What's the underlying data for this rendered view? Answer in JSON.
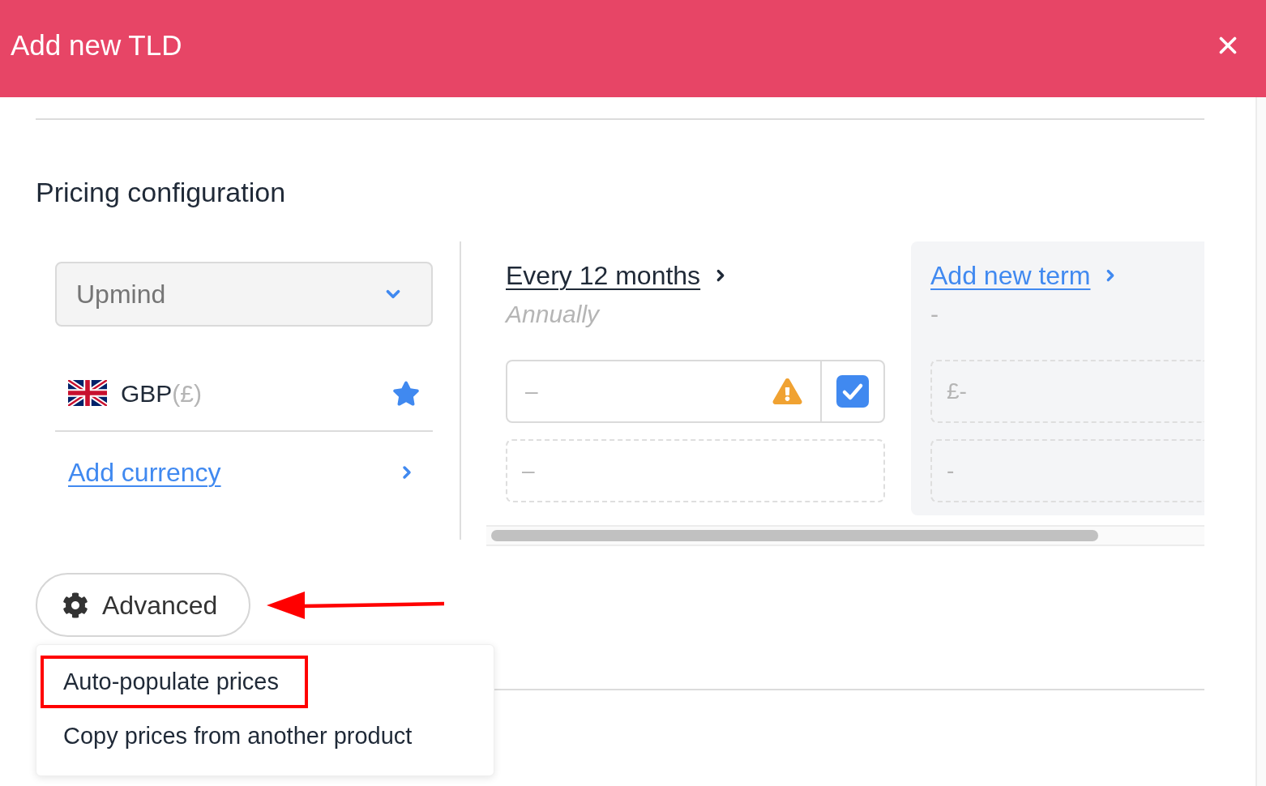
{
  "dialog": {
    "title": "Add new TLD"
  },
  "section": {
    "title": "Pricing configuration"
  },
  "brand_select": {
    "value": "Upmind"
  },
  "currencies": [
    {
      "code": "GBP",
      "symbol": "(£)",
      "default": true
    }
  ],
  "add_currency_link": "Add currency",
  "terms": [
    {
      "kind": "term",
      "title": "Every 12 months",
      "subtitle": "Annually",
      "fields": [
        {
          "kind": "price",
          "placeholder": "–",
          "warning": true,
          "checked": true
        },
        {
          "kind": "dashed",
          "placeholder": "–"
        }
      ]
    },
    {
      "kind": "add",
      "title": "Add new term",
      "subtitle": "-",
      "fields": [
        {
          "kind": "dashed",
          "placeholder": "£-"
        },
        {
          "kind": "dashed",
          "placeholder": "-"
        }
      ]
    }
  ],
  "advanced_button": {
    "label": "Advanced",
    "annotated": true
  },
  "advanced_menu": {
    "items": [
      {
        "label": "Auto-populate prices",
        "highlighted": true
      },
      {
        "label": "Copy prices from another product",
        "highlighted": false
      }
    ]
  }
}
